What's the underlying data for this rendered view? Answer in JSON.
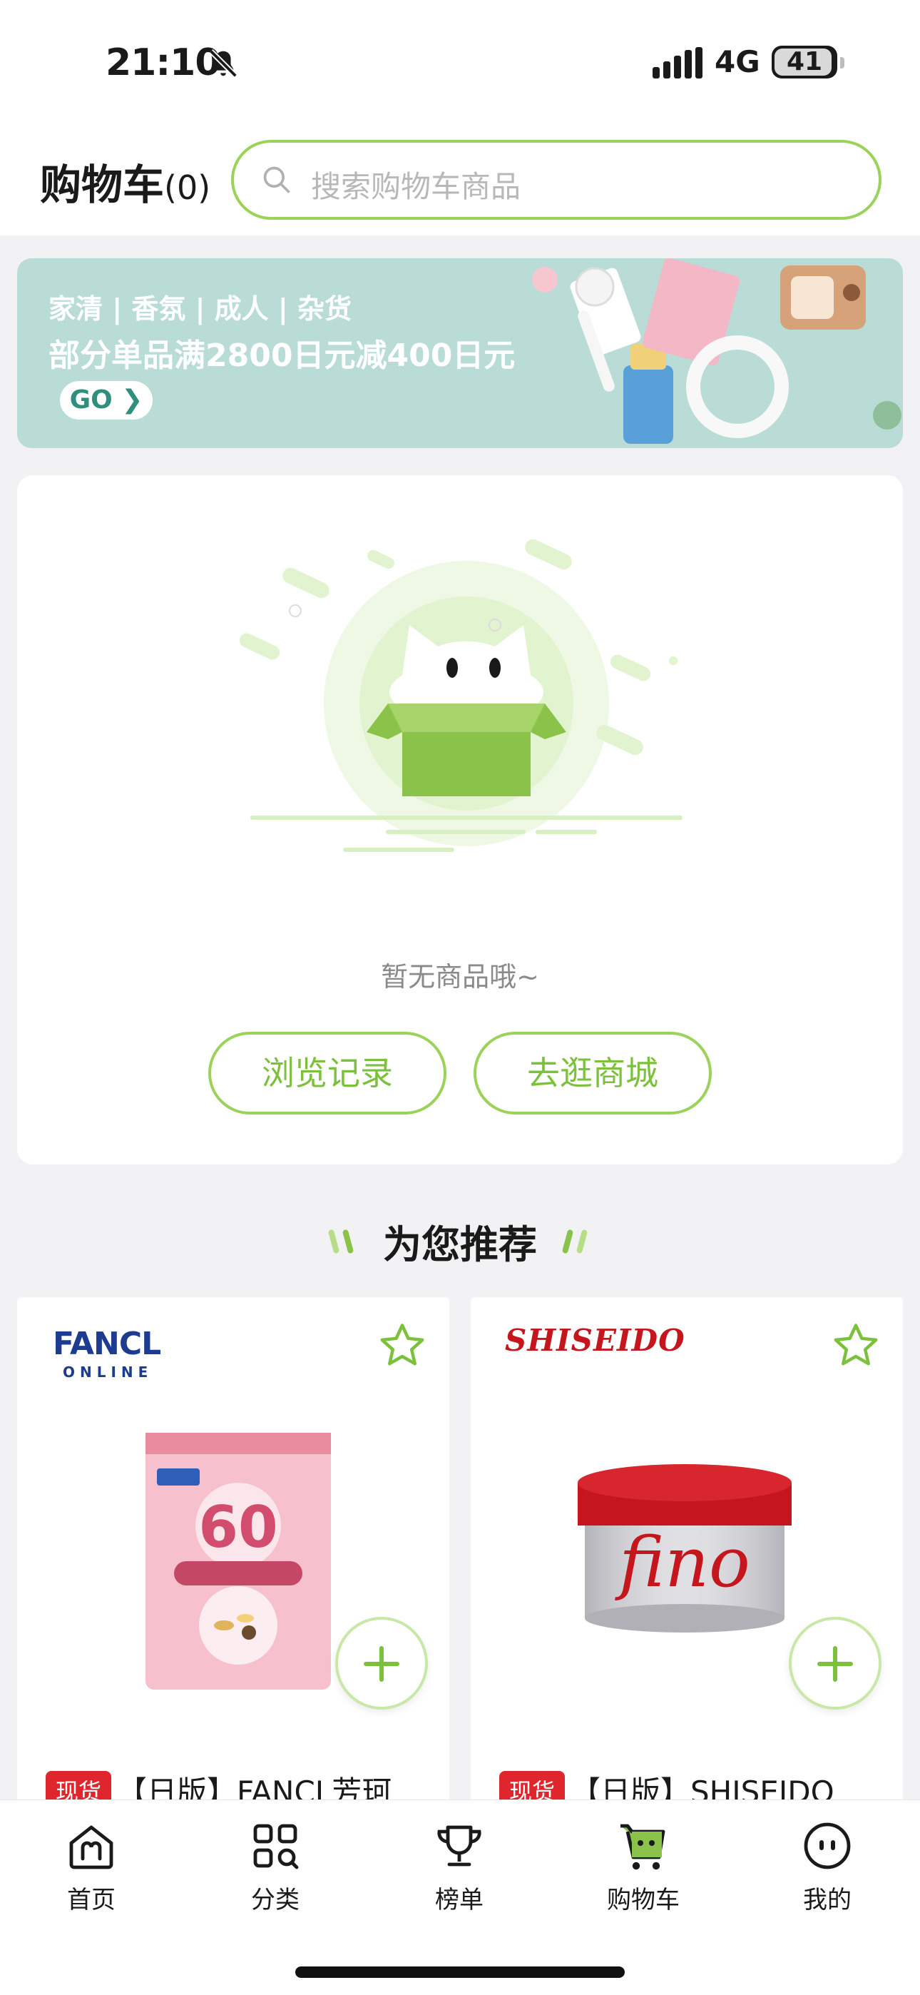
{
  "status_bar": {
    "time": "21:10",
    "network": "4G",
    "battery": "41"
  },
  "header": {
    "title": "购物车",
    "count": "(0)",
    "search_placeholder": "搜索购物车商品"
  },
  "banner": {
    "categories": "家清 | 香氛 | 成人 | 杂货",
    "promo": "部分单品满2800日元减400日元",
    "go_label": "GO ❯"
  },
  "empty_state": {
    "message": "暂无商品哦~",
    "history_button": "浏览记录",
    "shop_button": "去逛商城"
  },
  "recommend": {
    "title": "为您推荐",
    "products": [
      {
        "brand_line1": "FANCL",
        "brand_line2": "ONLINE",
        "tag": "现货",
        "name": "【日版】FANCL芳珂"
      },
      {
        "brand": "SHISEIDO",
        "tag": "现货",
        "name": "【日版】SHISEIDO"
      }
    ]
  },
  "tabbar": {
    "items": [
      {
        "label": "首页",
        "icon": "home-icon"
      },
      {
        "label": "分类",
        "icon": "category-icon"
      },
      {
        "label": "榜单",
        "icon": "trophy-icon"
      },
      {
        "label": "购物车",
        "icon": "cart-icon"
      },
      {
        "label": "我的",
        "icon": "profile-icon"
      }
    ],
    "active": "购物车"
  },
  "colors": {
    "accent": "#7cc13b",
    "accent_light": "#9bd35a",
    "tag_red": "#e0262d",
    "banner_bg": "#b9ddd6"
  }
}
